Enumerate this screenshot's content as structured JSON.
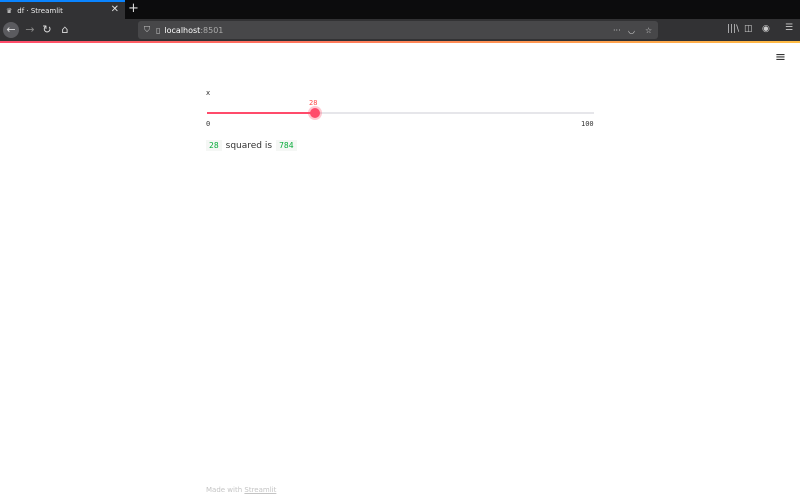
{
  "browser": {
    "tab_title": "df · Streamlit",
    "url_host": "localhost",
    "url_port": ":8501"
  },
  "slider": {
    "label": "x",
    "value": 28,
    "min": "0",
    "max": "100",
    "value_text": "28",
    "accent": "#ff4b6b"
  },
  "result": {
    "input": "28",
    "text": "squared is",
    "output": "784"
  },
  "footer": {
    "prefix": "Made with",
    "link": "Streamlit"
  }
}
